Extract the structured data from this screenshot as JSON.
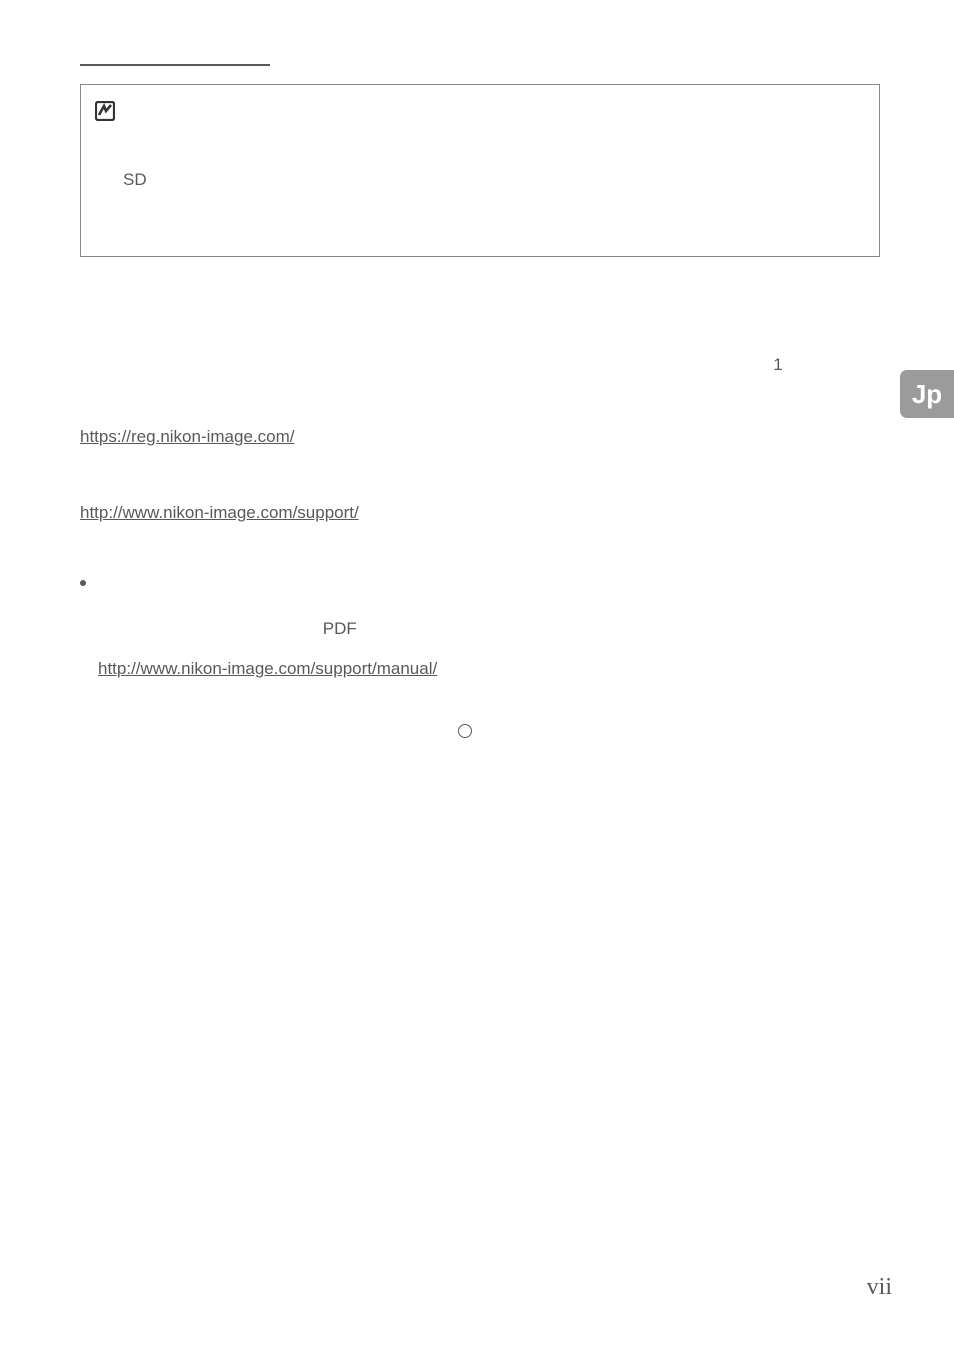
{
  "infoBox": {
    "sdText": "SD"
  },
  "rightCol": {
    "num1": "1"
  },
  "links": {
    "reg": "https://reg.nikon-image.com/",
    "support": "http://www.nikon-image.com/support/",
    "manual": "http://www.nikon-image.com/support/manual/"
  },
  "bullet": {
    "pdfLabel": "PDF",
    "circleLabel": "O"
  },
  "langTab": "Jp",
  "pageNumber": "vii"
}
